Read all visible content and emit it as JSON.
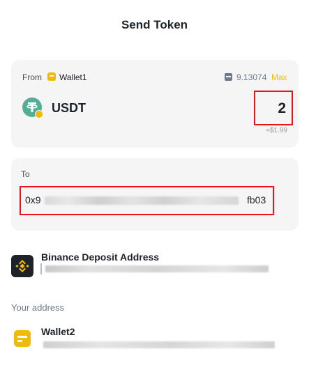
{
  "header": {
    "title": "Send Token"
  },
  "from": {
    "label": "From",
    "wallet_name": "Wallet1",
    "wallet_icon": "wallet-icon",
    "balance": "9.13074",
    "balance_icon": "wallet-balance-icon",
    "max_label": "Max",
    "token_symbol": "USDT",
    "token_icon": "tether-icon",
    "amount": "2",
    "usd_value": "≈$1.99"
  },
  "to": {
    "label": "To",
    "address_prefix": "0x9",
    "address_suffix": "fb03"
  },
  "suggestions": {
    "binance_deposit": {
      "title": "Binance Deposit Address",
      "icon": "binance-logo-icon"
    },
    "your_address_label": "Your address",
    "wallet2": {
      "title": "Wallet2",
      "icon": "wallet-icon"
    }
  },
  "colors": {
    "accent": "#f0b90b",
    "highlight_border": "#e8121a",
    "card_bg": "#f5f5f5",
    "tether": "#50af95",
    "text_primary": "#1e2329",
    "text_secondary": "#707a8a"
  }
}
